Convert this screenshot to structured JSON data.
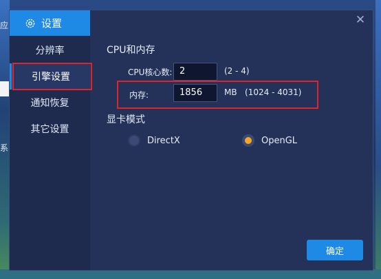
{
  "background": {
    "edge_text_top": "应",
    "edge_text_mid": "系"
  },
  "sidebar": {
    "title": "设置",
    "title_icon": "gear-icon",
    "items": [
      {
        "label": "分辨率",
        "active": false
      },
      {
        "label": "引擎设置",
        "active": true
      },
      {
        "label": "通知恢复",
        "active": false
      },
      {
        "label": "其它设置",
        "active": false
      }
    ]
  },
  "main": {
    "close_icon": "close-icon",
    "cpu_section": {
      "title": "CPU和内存",
      "cpu_label": "CPU核心数:",
      "cpu_value": "2",
      "cpu_range": "(2 - 4)",
      "mem_label": "内存:",
      "mem_value": "1856",
      "mem_unit_range": "MB   (1024 - 4031)"
    },
    "gpu_section": {
      "title": "显卡模式",
      "options": [
        {
          "label": "DirectX",
          "checked": false
        },
        {
          "label": "OpenGL",
          "checked": true
        }
      ]
    },
    "confirm_label": "确定"
  },
  "colors": {
    "accent": "#1e8ae6",
    "highlight": "#e0242b",
    "radio_selected": "#f5a623"
  }
}
